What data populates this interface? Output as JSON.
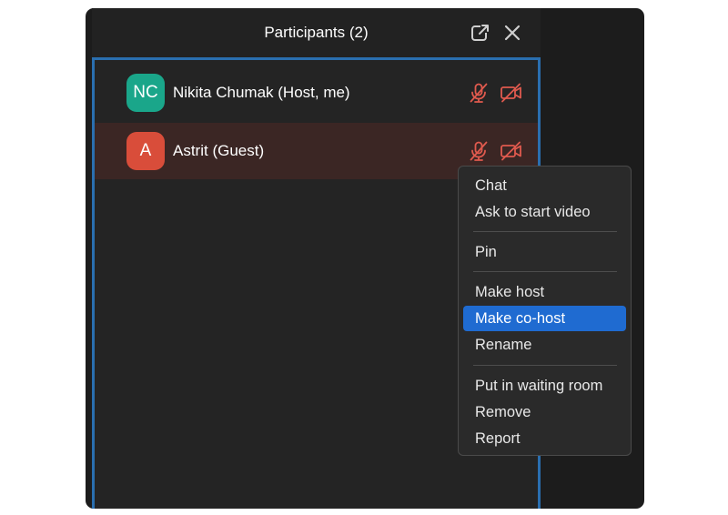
{
  "panel": {
    "title": "Participants (2)",
    "icons": {
      "popout": "popout-icon",
      "close": "close-icon"
    }
  },
  "participants": [
    {
      "initials": "NC",
      "name": "Nikita Chumak (Host, me)",
      "avatar_color": "#1aa68a",
      "highlighted": false,
      "mic": "muted",
      "video": "off"
    },
    {
      "initials": "A",
      "name": "Astrit (Guest)",
      "avatar_color": "#d94d3a",
      "highlighted": true,
      "mic": "muted",
      "video": "off"
    }
  ],
  "context_menu": {
    "groups": [
      [
        "Chat",
        "Ask to start video"
      ],
      [
        "Pin"
      ],
      [
        "Make host",
        "Make co-host",
        "Rename"
      ],
      [
        "Put in waiting room",
        "Remove",
        "Report"
      ]
    ],
    "active_item": "Make co-host"
  },
  "colors": {
    "accent": "#1f6bd1",
    "frame_border": "#2a6fb0",
    "muted_red": "#e05a4e",
    "highlight_row": "#3b2624"
  }
}
